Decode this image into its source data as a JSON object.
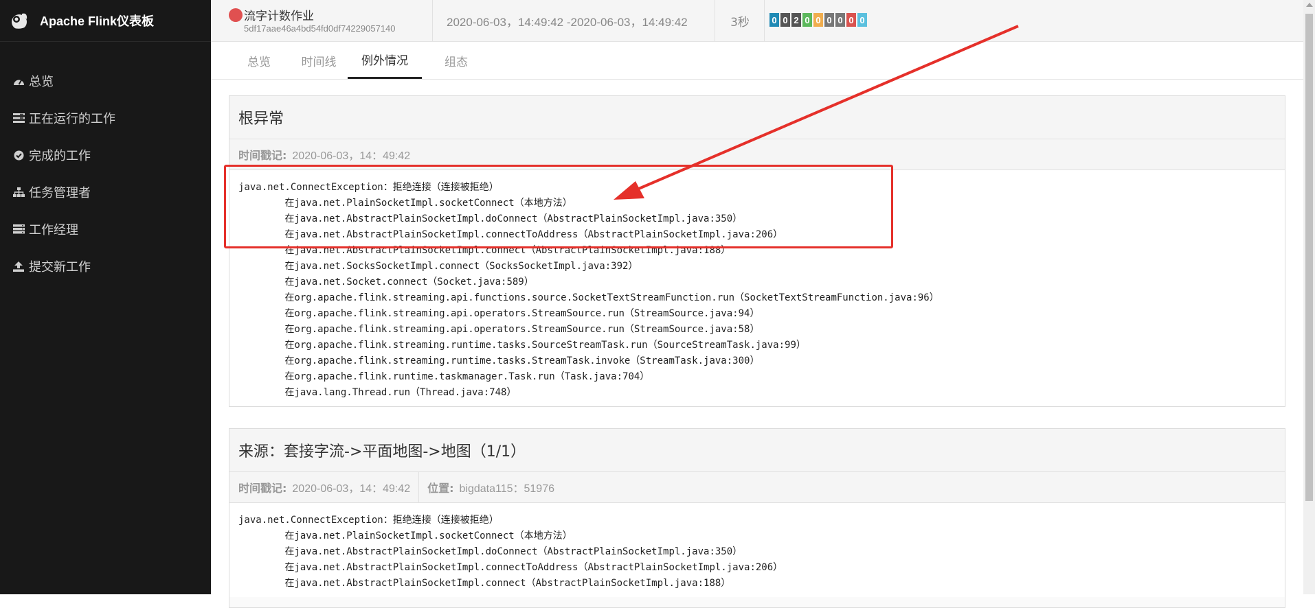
{
  "brand": {
    "title": "Apache Flink仪表板",
    "logo_icon": "squirrel-logo"
  },
  "sidebar": {
    "items": [
      {
        "label": "总览",
        "icon": "dashboard-icon"
      },
      {
        "label": "正在运行的工作",
        "icon": "tasks-icon"
      },
      {
        "label": "完成的工作",
        "icon": "check-circle-icon"
      },
      {
        "label": "任务管理者",
        "icon": "sitemap-icon"
      },
      {
        "label": "工作经理",
        "icon": "server-icon"
      },
      {
        "label": "提交新工作",
        "icon": "upload-icon"
      }
    ]
  },
  "header": {
    "job_name": "流字计数作业",
    "job_id": "5df17aae46a4bd54fd0df74229057140",
    "time_range": "2020-06-03，14:49:42 -2020-06-03，14:49:42",
    "duration": "3秒",
    "badges": [
      {
        "value": "0",
        "color": "#1f8ab5"
      },
      {
        "value": "0",
        "color": "#555555"
      },
      {
        "value": "2",
        "color": "#555555"
      },
      {
        "value": "0",
        "color": "#5cb85c"
      },
      {
        "value": "0",
        "color": "#f0ad4e"
      },
      {
        "value": "0",
        "color": "#777777"
      },
      {
        "value": "0",
        "color": "#777777"
      },
      {
        "value": "0",
        "color": "#d9534f"
      },
      {
        "value": "0",
        "color": "#5bc0de"
      }
    ]
  },
  "tabs": [
    {
      "label": "总览"
    },
    {
      "label": "时间线"
    },
    {
      "label": "例外情况"
    },
    {
      "label": "组态"
    }
  ],
  "root_exception": {
    "title": "根异常",
    "timestamp_label": "时间戳记:",
    "timestamp": "2020-06-03，14：49:42",
    "trace": "java.net.ConnectException：拒绝连接（连接被拒绝）\n\t在java.net.PlainSocketImpl.socketConnect（本地方法）\n\t在java.net.AbstractPlainSocketImpl.doConnect（AbstractPlainSocketImpl.java:350）\n\t在java.net.AbstractPlainSocketImpl.connectToAddress（AbstractPlainSocketImpl.java:206）\n\t在java.net.AbstractPlainSocketImpl.connect（AbstractPlainSocketImpl.java:188）\n\t在java.net.SocksSocketImpl.connect（SocksSocketImpl.java:392）\n\t在java.net.Socket.connect（Socket.java:589）\n\t在org.apache.flink.streaming.api.functions.source.SocketTextStreamFunction.run（SocketTextStreamFunction.java:96）\n\t在org.apache.flink.streaming.api.operators.StreamSource.run（StreamSource.java:94）\n\t在org.apache.flink.streaming.api.operators.StreamSource.run（StreamSource.java:58）\n\t在org.apache.flink.streaming.runtime.tasks.SourceStreamTask.run（SourceStreamTask.java:99）\n\t在org.apache.flink.streaming.runtime.tasks.StreamTask.invoke（StreamTask.java:300）\n\t在org.apache.flink.runtime.taskmanager.Task.run（Task.java:704）\n\t在java.lang.Thread.run（Thread.java:748）"
  },
  "source_exception": {
    "title": "来源：套接字流->平面地图->地图（1/1）",
    "timestamp_label": "时间戳记:",
    "timestamp": "2020-06-03，14：49:42",
    "location_label": "位置:",
    "location": "bigdata115：51976",
    "trace": "java.net.ConnectException：拒绝连接（连接被拒绝）\n\t在java.net.PlainSocketImpl.socketConnect（本地方法）\n\t在java.net.AbstractPlainSocketImpl.doConnect（AbstractPlainSocketImpl.java:350）\n\t在java.net.AbstractPlainSocketImpl.connectToAddress（AbstractPlainSocketImpl.java:206）\n\t在java.net.AbstractPlainSocketImpl.connect（AbstractPlainSocketImpl.java:188）"
  },
  "annotation": {
    "color": "#e5302a"
  }
}
